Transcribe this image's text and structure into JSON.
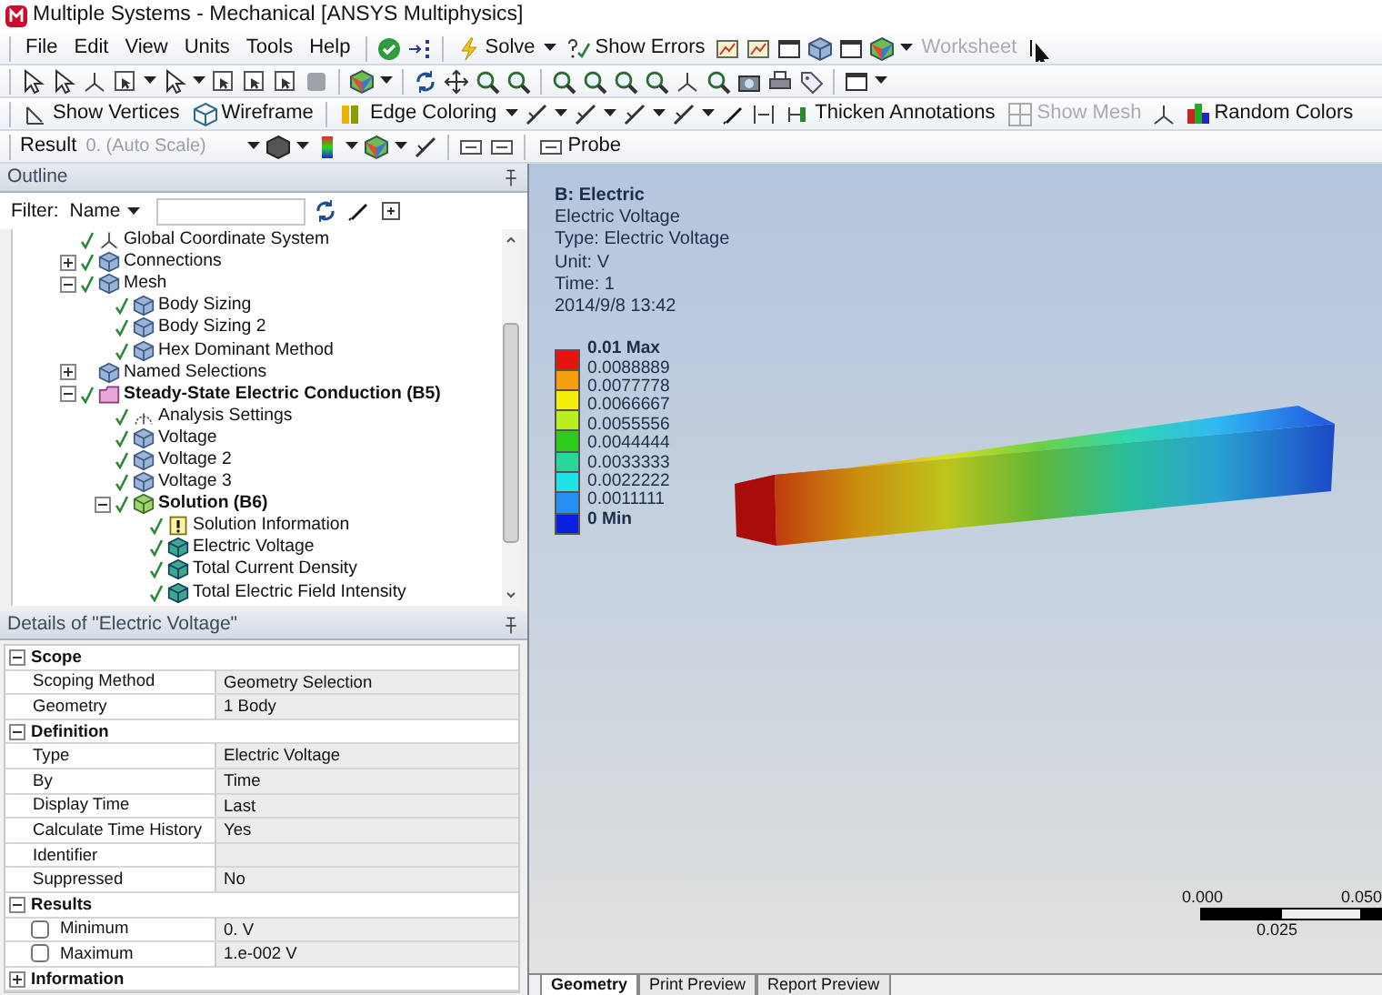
{
  "window": {
    "title": "Multiple Systems - Mechanical [ANSYS Multiphysics]"
  },
  "menu": [
    "File",
    "Edit",
    "View",
    "Units",
    "Tools",
    "Help"
  ],
  "toolbar_1": {
    "buttons": [
      {
        "label": "Solve",
        "disabled": false
      },
      {
        "label": "Show Errors",
        "disabled": false
      },
      {
        "label": "Worksheet",
        "disabled": true
      }
    ]
  },
  "toolbar_3": {
    "buttons": [
      {
        "label": "Show Vertices",
        "disabled": false
      },
      {
        "label": "Wireframe",
        "disabled": false
      },
      {
        "label": "Edge Coloring",
        "disabled": false
      },
      {
        "label": "Thicken Annotations",
        "disabled": false
      },
      {
        "label": "Show Mesh",
        "disabled": true
      },
      {
        "label": "Random Colors",
        "disabled": false
      }
    ]
  },
  "result_toolbar": {
    "label": "Result",
    "scale": {
      "placeholder": "0. (Auto Scale)"
    },
    "probe": "Probe"
  },
  "outline": {
    "title": "Outline",
    "filter_label": "Filter:",
    "filter_select": "Name",
    "tree": [
      {
        "label": "Global Coordinate System",
        "kind": "coordinate",
        "checked": true
      },
      {
        "label": "Connections",
        "kind": "group",
        "checked": true,
        "expanded": false
      },
      {
        "label": "Mesh",
        "kind": "group",
        "checked": true,
        "expanded": true,
        "children": [
          {
            "label": "Body Sizing",
            "kind": "control",
            "checked": true
          },
          {
            "label": "Body Sizing 2",
            "kind": "control",
            "checked": true
          },
          {
            "label": "Hex Dominant Method",
            "kind": "method",
            "checked": true
          }
        ]
      },
      {
        "label": "Named Selections",
        "kind": "selection",
        "checked": false,
        "expanded": false
      },
      {
        "label": "Steady-State Electric Conduction (B5)",
        "kind": "analysis",
        "checked": true,
        "expanded": true,
        "children": [
          {
            "label": "Analysis Settings",
            "kind": "settings",
            "checked": true
          },
          {
            "label": "Voltage",
            "kind": "control",
            "checked": true
          },
          {
            "label": "Voltage 2",
            "kind": "control",
            "checked": true
          },
          {
            "label": "Voltage 3",
            "kind": "control",
            "checked": true
          },
          {
            "label": "Solution (B6)",
            "kind": "solution",
            "checked": true,
            "expanded": true,
            "children": [
              {
                "label": "Solution Information",
                "kind": "info",
                "checked": true
              },
              {
                "label": "Electric Voltage",
                "kind": "result",
                "checked": true
              },
              {
                "label": "Total Current Density",
                "kind": "result",
                "checked": true
              },
              {
                "label": "Total Electric Field Intensity",
                "kind": "result",
                "checked": true
              }
            ]
          }
        ]
      }
    ]
  },
  "details": {
    "title": "Details of \"Electric Voltage\"",
    "sections": [
      {
        "title": "Scope",
        "expanded": true,
        "rows": [
          {
            "label": "Scoping Method",
            "value": "Geometry Selection"
          },
          {
            "label": "Geometry",
            "value": "1 Body"
          }
        ]
      },
      {
        "title": "Definition",
        "expanded": true,
        "rows": [
          {
            "label": "Type",
            "value": "Electric Voltage"
          },
          {
            "label": "By",
            "value": "Time"
          },
          {
            "label": "Display Time",
            "value": "Last"
          },
          {
            "label": "Calculate Time History",
            "value": "Yes"
          },
          {
            "label": "Identifier"
          },
          {
            "label": "Suppressed",
            "value": "No"
          }
        ]
      },
      {
        "title": "Results",
        "expanded": true,
        "rows": [
          {
            "label": "Minimum",
            "value": "0. V",
            "checked": false
          },
          {
            "label": "Maximum",
            "value": "1.e-002 V",
            "checked": false
          }
        ]
      },
      {
        "title": "Information",
        "expanded": false
      }
    ]
  },
  "viewport": {
    "title": "B: Electric",
    "lines": [
      "Electric Voltage",
      "Type: Electric Voltage",
      "Unit: V",
      "Time: 1",
      "2014/9/8 13:42"
    ],
    "legend": {
      "labels": [
        "0.01 Max",
        "0.0088889",
        "0.0077778",
        "0.0066667",
        "0.0055556",
        "0.0044444",
        "0.0033333",
        "0.0022222",
        "0.0011111",
        "0 Min"
      ],
      "bands": [
        {
          "color": "#e8130f"
        },
        {
          "color": "#f5a00a"
        },
        {
          "color": "#f3ee0e"
        },
        {
          "color": "#b9ee22"
        },
        {
          "color": "#2ccb1c"
        },
        {
          "color": "#27d89a"
        },
        {
          "color": "#1fe3e6"
        },
        {
          "color": "#2590f0"
        },
        {
          "color": "#0b1fe0"
        }
      ]
    },
    "scale_bar": {
      "start": "0.000",
      "end": "0.050",
      "middle": "0.025"
    },
    "tabs": [
      {
        "label": "Geometry",
        "selected": true
      },
      {
        "label": "Print Preview",
        "selected": false
      },
      {
        "label": "Report Preview",
        "selected": false
      }
    ]
  }
}
